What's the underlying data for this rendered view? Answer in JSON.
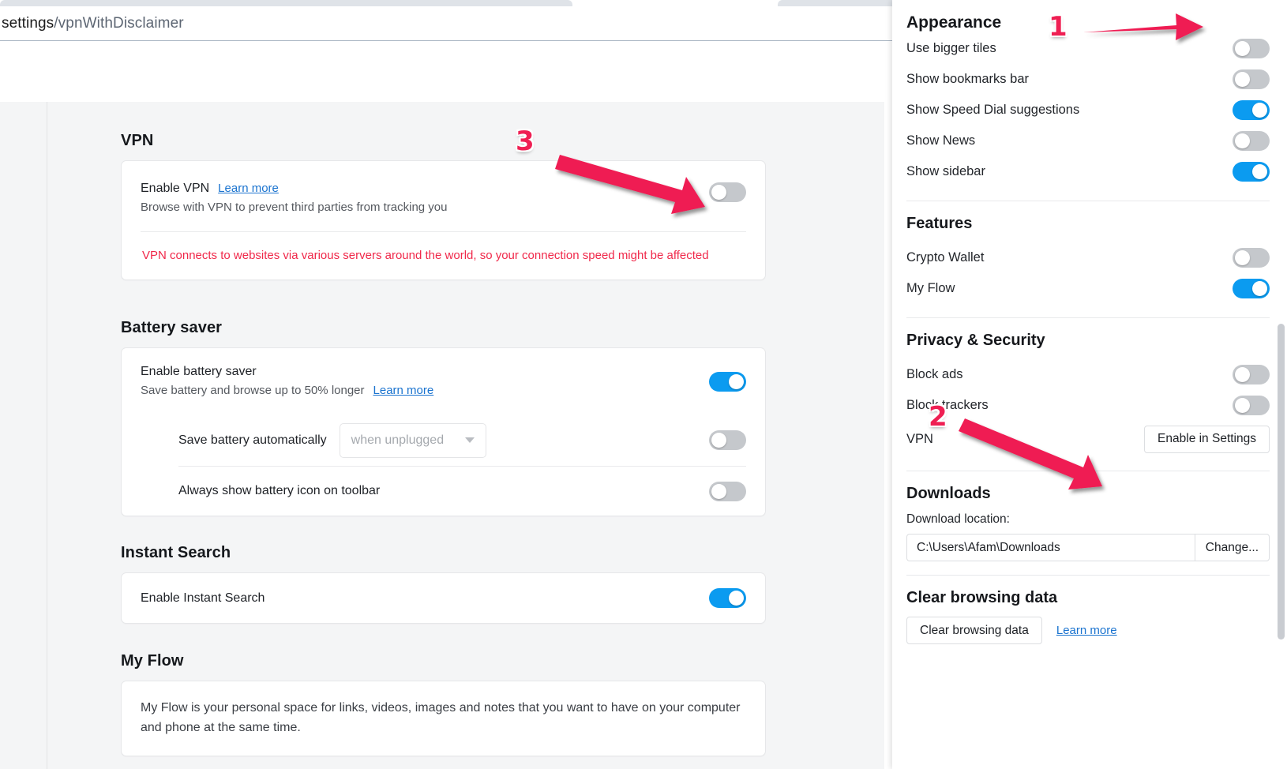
{
  "browser": {
    "url_prefix": "settings",
    "url_sep": "/",
    "url_page": "vpnWithDisclaimer",
    "toolbar_icons": [
      "camera-icon",
      "messenger-icon",
      "panel-icon",
      "easy-setup-icon"
    ]
  },
  "settings": {
    "vpn": {
      "section_title": "VPN",
      "enable_label": "Enable VPN",
      "learn_more": "Learn more",
      "description": "Browse with VPN to prevent third parties from tracking you",
      "toggle_state": "off",
      "disclaimer": "VPN connects to websites via various servers around the world, so your connection speed might be affected"
    },
    "battery": {
      "section_title": "Battery saver",
      "enable_label": "Enable battery saver",
      "enable_sub": "Save battery and browse up to 50% longer",
      "learn_more": "Learn more",
      "enable_toggle_state": "on",
      "auto_label": "Save battery automatically",
      "auto_select_value": "when unplugged",
      "auto_toggle_state": "off",
      "icon_label": "Always show battery icon on toolbar",
      "icon_toggle_state": "off"
    },
    "instant_search": {
      "section_title": "Instant Search",
      "enable_label": "Enable Instant Search",
      "toggle_state": "on"
    },
    "my_flow": {
      "section_title": "My Flow",
      "description": "My Flow is your personal space for links, videos, images and notes that you want to have on your computer and phone at the same time."
    }
  },
  "easy_setup": {
    "cut_off_heading": "Appearance",
    "appearance_items": [
      {
        "label": "Use bigger tiles",
        "state": "off"
      },
      {
        "label": "Show bookmarks bar",
        "state": "off"
      },
      {
        "label": "Show Speed Dial suggestions",
        "state": "on"
      },
      {
        "label": "Show News",
        "state": "off"
      },
      {
        "label": "Show sidebar",
        "state": "on"
      }
    ],
    "features": {
      "heading": "Features",
      "items": [
        {
          "label": "Crypto Wallet",
          "state": "off"
        },
        {
          "label": "My Flow",
          "state": "on"
        }
      ]
    },
    "privacy": {
      "heading": "Privacy & Security",
      "items": [
        {
          "label": "Block ads",
          "state": "off"
        },
        {
          "label": "Block trackers",
          "state": "off"
        }
      ],
      "vpn_label": "VPN",
      "vpn_button": "Enable in Settings"
    },
    "downloads": {
      "heading": "Downloads",
      "location_label": "Download location:",
      "location_value": "C:\\Users\\Afam\\Downloads",
      "change_button": "Change..."
    },
    "clear_browsing": {
      "heading": "Clear browsing data",
      "button": "Clear browsing data",
      "learn_more": "Learn more"
    }
  },
  "annotations": {
    "marker1": "1",
    "marker2": "2",
    "marker3": "3",
    "arrow_color": "#ef1f53"
  }
}
